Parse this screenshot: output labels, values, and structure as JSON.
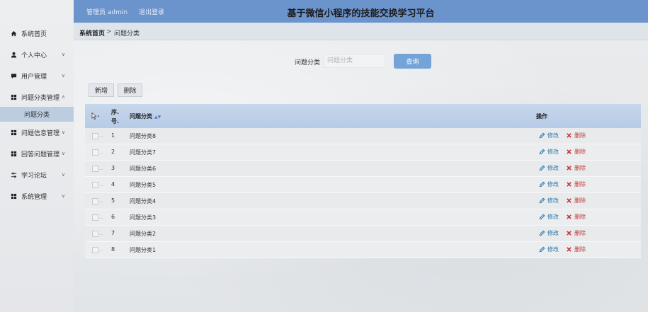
{
  "header": {
    "admin_label": "管理员 admin",
    "logout": "退出登录",
    "title": "基于微信小程序的技能交换学习平台"
  },
  "sidebar": {
    "items": [
      {
        "label": "系统首页",
        "icon": "home-icon",
        "has_chevron": false
      },
      {
        "label": "个人中心",
        "icon": "user-icon",
        "has_chevron": true
      },
      {
        "label": "用户管理",
        "icon": "chat-icon",
        "has_chevron": true
      },
      {
        "label": "问题分类管理",
        "icon": "grid-icon",
        "has_chevron": true,
        "expanded": true
      },
      {
        "label": "问题信息管理",
        "icon": "grid-icon",
        "has_chevron": true
      },
      {
        "label": "回答问题管理",
        "icon": "grid-icon",
        "has_chevron": true
      },
      {
        "label": "学习论坛",
        "icon": "sliders-icon",
        "has_chevron": true
      },
      {
        "label": "系统管理",
        "icon": "grid-icon",
        "has_chevron": true
      }
    ],
    "sub_item": "问题分类"
  },
  "breadcrumb": {
    "home": "系统首页",
    "separator": ">",
    "current": "问题分类"
  },
  "search": {
    "label": "问题分类",
    "placeholder": "问题分类",
    "value": "",
    "button": "查询"
  },
  "toolbar": {
    "add": "新增",
    "delete": "删除"
  },
  "table": {
    "col_index_line1": "序.",
    "col_index_line2": "号.",
    "col_category": "问题分类",
    "col_actions": "操作",
    "edit_label": "修改",
    "delete_label": "删除",
    "rows": [
      {
        "index": "1",
        "category": "问题分类8"
      },
      {
        "index": "2",
        "category": "问题分类7"
      },
      {
        "index": "3",
        "category": "问题分类6"
      },
      {
        "index": "4",
        "category": "问题分类5"
      },
      {
        "index": "5",
        "category": "问题分类4"
      },
      {
        "index": "6",
        "category": "问题分类3"
      },
      {
        "index": "7",
        "category": "问题分类2"
      },
      {
        "index": "8",
        "category": "问题分类1"
      }
    ]
  },
  "colors": {
    "header": "#6b93cc",
    "accent": "#74a3d8",
    "edit": "#2b78a8",
    "delete": "#c33a3a",
    "submenu_active": "#bdcde0"
  }
}
